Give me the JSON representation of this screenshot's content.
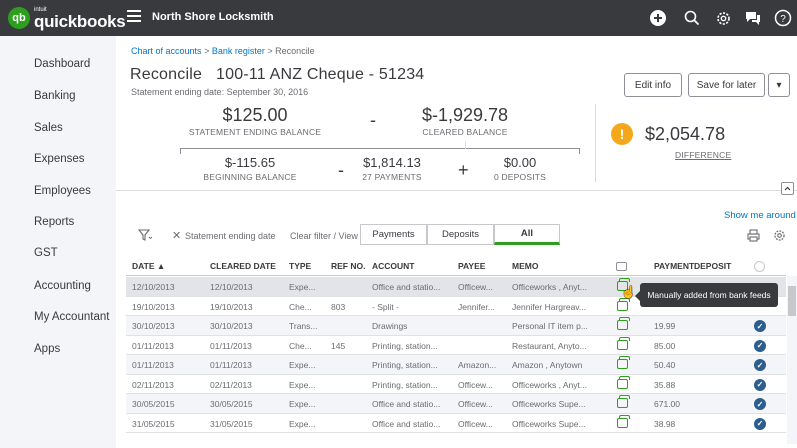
{
  "brand": {
    "name": "quickbooks",
    "sub": "intuit",
    "badge": "qb"
  },
  "company": "North Shore Locksmith",
  "top_icons": [
    "plus-icon",
    "search-icon",
    "gear-icon",
    "chat-icon",
    "help-icon"
  ],
  "sidebar": {
    "items": [
      {
        "label": "Dashboard"
      },
      {
        "label": "Banking"
      },
      {
        "label": "Sales"
      },
      {
        "label": "Expenses"
      },
      {
        "label": "Employees"
      },
      {
        "label": "Reports"
      },
      {
        "label": "GST"
      },
      {
        "label": "Accounting"
      },
      {
        "label": "My Accountant"
      },
      {
        "label": "Apps"
      }
    ]
  },
  "breadcrumb": {
    "a": "Chart of accounts",
    "sep1": ">",
    "b": "Bank register",
    "sep2": ">",
    "c": "Reconcile"
  },
  "page": {
    "title": "Reconcile   100-11 ANZ Cheque - 51234",
    "subtitle": "Statement ending date: September 30, 2016"
  },
  "buttons": {
    "edit_info": "Edit info",
    "save_for_later": "Save for later",
    "dropdown": "▾"
  },
  "balances": {
    "statement_ending": {
      "value": "$125.00",
      "label": "STATEMENT ENDING BALANCE"
    },
    "op_minus": "-",
    "cleared": {
      "value": "$-1,929.78",
      "label": "CLEARED BALANCE"
    },
    "beginning": {
      "value": "$-115.65",
      "label": "BEGINNING BALANCE"
    },
    "op_minus2": "-",
    "payments": {
      "value": "$1,814.13",
      "label": "27 PAYMENTS"
    },
    "op_plus": "+",
    "deposits": {
      "value": "$0.00",
      "label": "0 DEPOSITS"
    },
    "difference": {
      "value": "$2,054.78",
      "label": "DIFFERENCE",
      "warn": "!"
    }
  },
  "filters": {
    "statement_filter": "Statement ending date",
    "clear": "Clear filter / View",
    "tabs": [
      {
        "label": "Payments"
      },
      {
        "label": "Deposits"
      },
      {
        "label": "All"
      }
    ],
    "active_tab": "All",
    "show_me": "Show me around"
  },
  "table": {
    "headers": {
      "date": "DATE ▲",
      "cleared": "CLEARED DATE",
      "type": "TYPE",
      "ref": "REF NO.",
      "account": "ACCOUNT",
      "payee": "PAYEE",
      "memo": "MEMO",
      "payment": "PAYMENT",
      "deposit": "DEPOSIT"
    },
    "rows": [
      {
        "date": "12/10/2013",
        "cleared": "12/10/2013",
        "type": "Expe...",
        "ref": "",
        "account": "Office and statio...",
        "payee": "Officew...",
        "memo": "Officeworks , Anyt...",
        "payment": "",
        "checked": false
      },
      {
        "date": "19/10/2013",
        "cleared": "19/10/2013",
        "type": "Che...",
        "ref": "803",
        "account": "- Split -",
        "payee": "Jennifer...",
        "memo": "Jennifer Hargreav...",
        "payment": "",
        "checked": false
      },
      {
        "date": "30/10/2013",
        "cleared": "30/10/2013",
        "type": "Trans...",
        "ref": "",
        "account": "Drawings",
        "payee": "",
        "memo": "Personal IT item p...",
        "payment": "19.99",
        "checked": true
      },
      {
        "date": "01/11/2013",
        "cleared": "01/11/2013",
        "type": "Che...",
        "ref": "145",
        "account": "Printing, station...",
        "payee": "",
        "memo": "Restaurant, Anyto...",
        "payment": "85.00",
        "checked": true
      },
      {
        "date": "01/11/2013",
        "cleared": "01/11/2013",
        "type": "Expe...",
        "ref": "",
        "account": "Printing, station...",
        "payee": "Amazon...",
        "memo": "Amazon , Anytown",
        "payment": "50.40",
        "checked": true
      },
      {
        "date": "02/11/2013",
        "cleared": "02/11/2013",
        "type": "Expe...",
        "ref": "",
        "account": "Printing, station...",
        "payee": "Officew...",
        "memo": "Officeworks , Anyt...",
        "payment": "35.88",
        "checked": true
      },
      {
        "date": "30/05/2015",
        "cleared": "30/05/2015",
        "type": "Expe...",
        "ref": "",
        "account": "Office and statio...",
        "payee": "Officew...",
        "memo": "Officeworks Supe...",
        "payment": "671.00",
        "checked": true
      },
      {
        "date": "31/05/2015",
        "cleared": "31/05/2015",
        "type": "Expe...",
        "ref": "",
        "account": "Office and statio...",
        "payee": "Officew...",
        "memo": "Officeworks Supe...",
        "payment": "38.98",
        "checked": true
      }
    ]
  },
  "tooltip": "Manually added from bank feeds",
  "colors": {
    "accent": "#2ca01c",
    "topbar": "#393a3d",
    "link": "#0077c5",
    "warning": "#f4a71a"
  }
}
